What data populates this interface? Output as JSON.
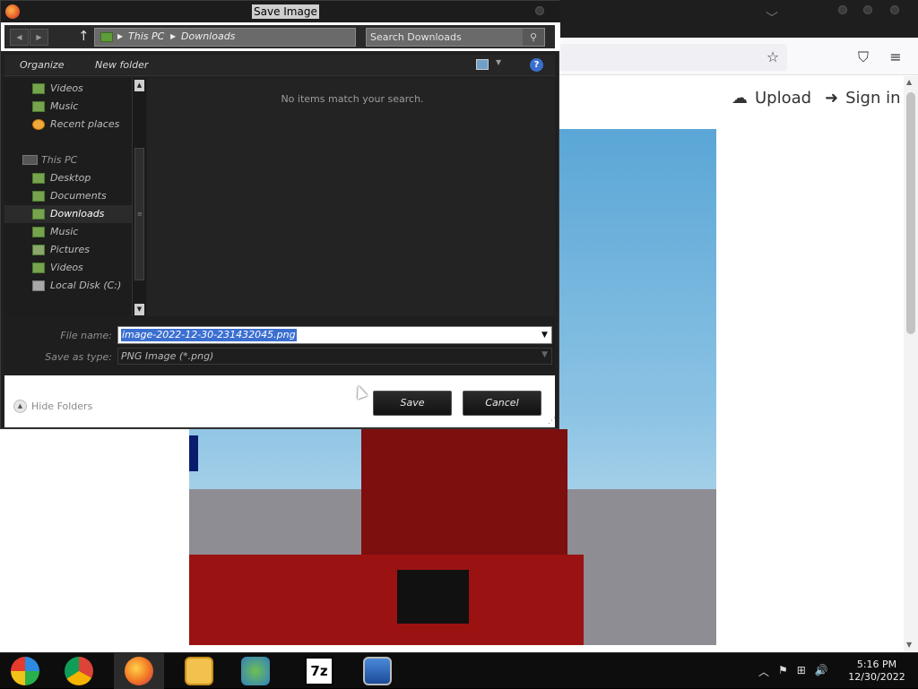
{
  "browser": {
    "upload_label": "Upload",
    "signin_label": "Sign in"
  },
  "dialog": {
    "title": "Save Image",
    "breadcrumb": [
      "This PC",
      "Downloads"
    ],
    "search_placeholder": "Search Downloads",
    "organize_label": "Organize",
    "new_folder_label": "New folder",
    "help_glyph": "?",
    "empty_message": "No items match your search.",
    "nav_items": [
      {
        "label": "Videos",
        "icon": "videos-folder-icon"
      },
      {
        "label": "Music",
        "icon": "music-folder-icon"
      },
      {
        "label": "Recent places",
        "icon": "recent-places-icon"
      },
      {
        "label": "This PC",
        "icon": "computer-icon"
      },
      {
        "label": "Desktop",
        "icon": "desktop-folder-icon"
      },
      {
        "label": "Documents",
        "icon": "documents-folder-icon"
      },
      {
        "label": "Downloads",
        "icon": "downloads-folder-icon"
      },
      {
        "label": "Music",
        "icon": "music-folder-icon"
      },
      {
        "label": "Pictures",
        "icon": "pictures-folder-icon"
      },
      {
        "label": "Videos",
        "icon": "videos-folder-icon"
      },
      {
        "label": "Local Disk (C:)",
        "icon": "disk-icon"
      }
    ],
    "selected_nav": "Downloads",
    "file_name_label": "File name:",
    "file_name_value": "image-2022-12-30-231432045.png",
    "save_type_label": "Save as type:",
    "save_type_value": "PNG Image (*.png)",
    "hide_folders_label": "Hide Folders",
    "save_button": "Save",
    "cancel_button": "Cancel"
  },
  "taskbar": {
    "apps": [
      "windows-icon",
      "chrome-icon",
      "firefox-icon",
      "file-explorer-icon",
      "network-people-icon",
      "7zip-icon",
      "remote-desktop-icon"
    ],
    "active_app": "firefox-icon",
    "time": "5:16 PM",
    "date": "12/30/2022"
  },
  "colors": {
    "dialog_bg": "#202020",
    "selection": "#3b6fd1",
    "taskbar": "#0d0d0d"
  }
}
